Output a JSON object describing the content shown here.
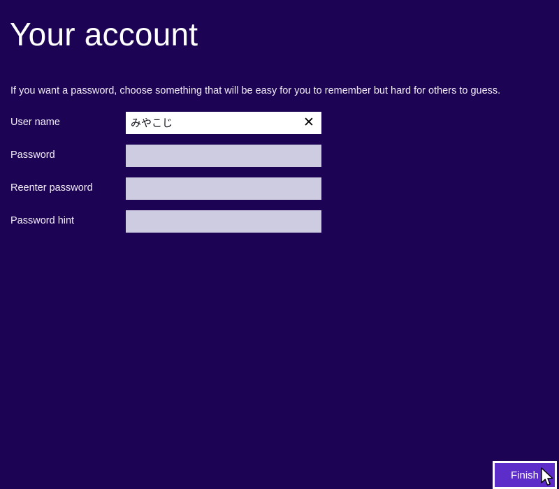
{
  "page": {
    "title": "Your account",
    "description": "If you want a password, choose something that will be easy for you to remember but hard for others to guess.",
    "background_color": "#1d0354",
    "accent_color": "#5c2dc8"
  },
  "form": {
    "fields": [
      {
        "label": "User name",
        "value": "みやこじ",
        "state": "active",
        "clear_icon": "✕"
      },
      {
        "label": "Password",
        "value": "",
        "state": "inactive"
      },
      {
        "label": "Reenter password",
        "value": "",
        "state": "inactive"
      },
      {
        "label": "Password hint",
        "value": "",
        "state": "inactive"
      }
    ]
  },
  "actions": {
    "finish_label": "Finish"
  }
}
